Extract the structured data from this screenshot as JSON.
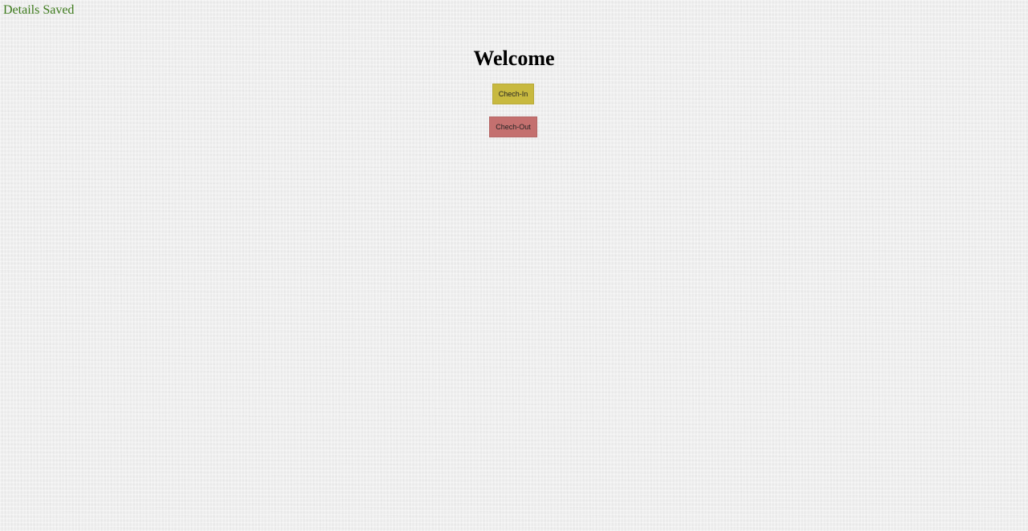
{
  "status": {
    "message": "Details Saved",
    "color": "#3d7a1c"
  },
  "main": {
    "title": "Welcome",
    "check_in_label": "Chech-In",
    "check_out_label": "Chech-Out"
  },
  "colors": {
    "check_in_button": "#c8b93f",
    "check_out_button": "#c4706f",
    "background": "#efefef"
  }
}
